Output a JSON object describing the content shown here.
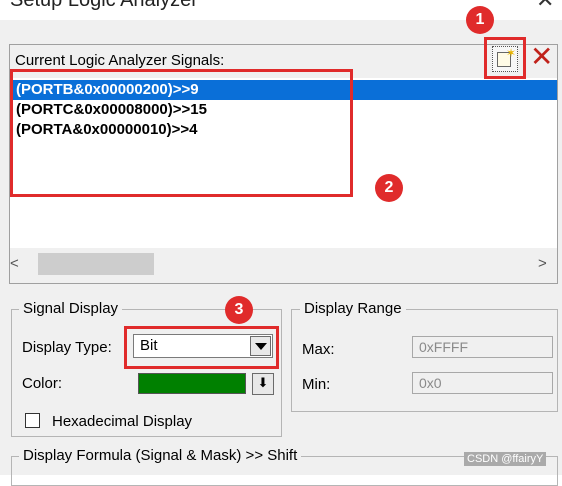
{
  "window": {
    "title": "Setup Logic Analyzer",
    "close_glyph": "✕"
  },
  "signals": {
    "label": "Current Logic Analyzer Signals:",
    "new_button_icon": "new-signal-icon",
    "delete_button_glyph": "✕",
    "items": [
      {
        "text": "(PORTB&0x00000200)>>9",
        "selected": true
      },
      {
        "text": "(PORTC&0x00008000)>>15",
        "selected": false
      },
      {
        "text": "(PORTA&0x00000010)>>4",
        "selected": false
      }
    ],
    "scroll_left_glyph": "<",
    "scroll_right_glyph": ">"
  },
  "signal_display": {
    "title": "Signal Display",
    "display_type_label": "Display Type:",
    "display_type_value": "Bit",
    "color_label": "Color:",
    "color_value": "#008000",
    "color_button_glyph": "⬇",
    "hex_label": "Hexadecimal Display",
    "hex_checked": false
  },
  "display_range": {
    "title": "Display Range",
    "max_label": "Max:",
    "max_value": "0xFFFF",
    "min_label": "Min:",
    "min_value": "0x0"
  },
  "formula": {
    "title": "Display Formula (Signal & Mask) >> Shift"
  },
  "annotations": {
    "badge1": "1",
    "badge2": "2",
    "badge3": "3",
    "color": "#e02b2b"
  },
  "watermark": "CSDN @ffairyY"
}
